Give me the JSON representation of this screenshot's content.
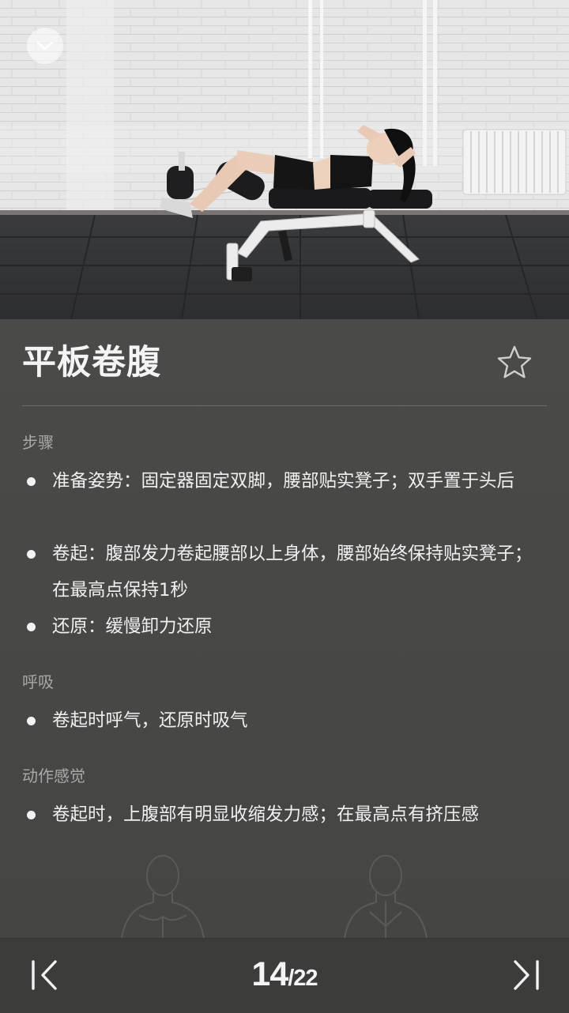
{
  "exercise": {
    "title": "平板卷腹"
  },
  "sections": [
    {
      "heading": "步骤",
      "items": [
        "准备姿势：固定器固定双脚，腰部贴实凳子；双手置于头后",
        "卷起：腹部发力卷起腰部以上身体，腰部始终保持贴实凳子；在最高点保持1秒",
        "还原：缓慢卸力还原"
      ]
    },
    {
      "heading": "呼吸",
      "items": [
        "卷起时呼气，还原时吸气"
      ]
    },
    {
      "heading": "动作感觉",
      "items": [
        "卷起时，上腹部有明显收缩发力感；在最高点有挤压感"
      ]
    }
  ],
  "pager": {
    "current": "14",
    "total": "/22"
  },
  "icons": {
    "collapse": "chevron-down-icon",
    "favorite": "star-outline-icon",
    "previous": "skip-previous-icon",
    "next": "skip-next-icon"
  },
  "colors": {
    "panel_bg": "#474747",
    "bottom_bar": "#3c3c3b",
    "section_heading": "#a9a9a9",
    "text": "#f0f0f0"
  }
}
